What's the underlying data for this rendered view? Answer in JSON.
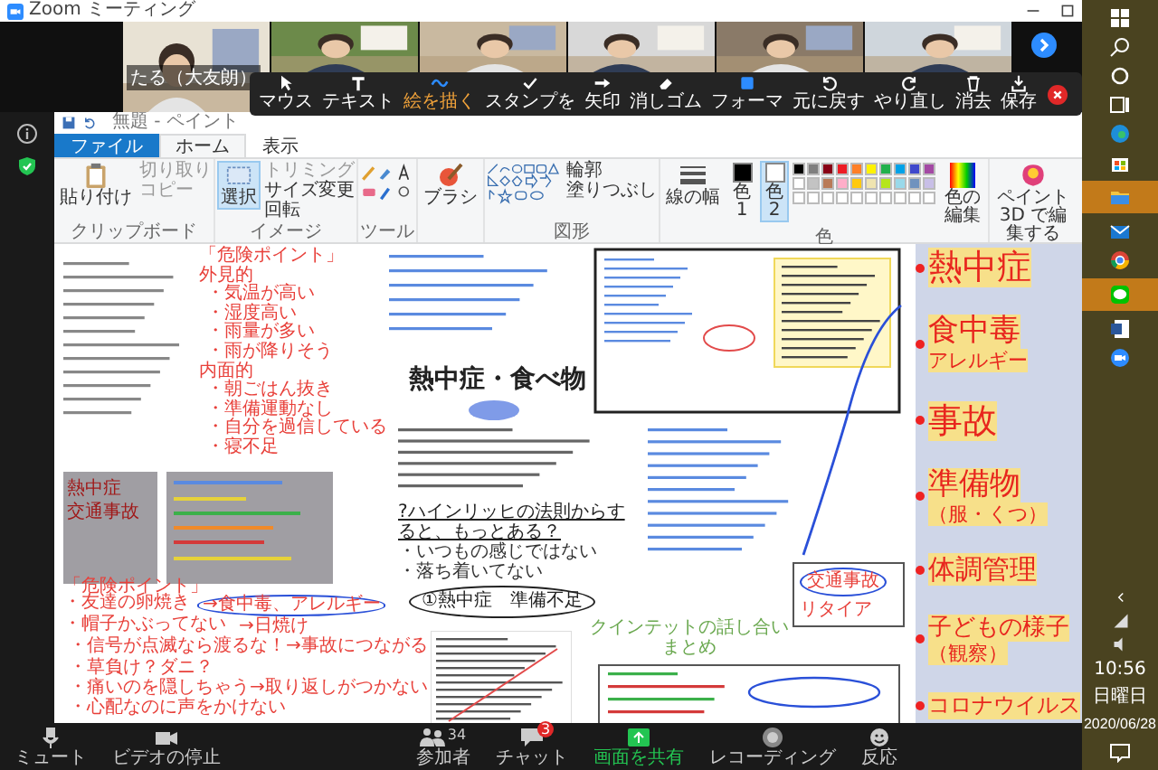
{
  "window": {
    "title": "Zoom ミーティング"
  },
  "video_tiles": [
    {
      "kind": "picture",
      "name": "たる（大友朗）"
    },
    {
      "kind": "picture"
    },
    {
      "kind": "picture"
    },
    {
      "kind": "picture"
    },
    {
      "kind": "picture"
    },
    {
      "kind": "picture"
    }
  ],
  "annotation_toolbar": {
    "tools": [
      {
        "kind": "mouse",
        "label": "マウス",
        "selected": false
      },
      {
        "kind": "text",
        "label": "テキスト",
        "selected": false
      },
      {
        "kind": "draw",
        "label": "絵を描く",
        "selected": true
      },
      {
        "kind": "stamp",
        "label": "スタンプを",
        "selected": false
      },
      {
        "kind": "arrow",
        "label": "矢印",
        "selected": false
      },
      {
        "kind": "eraser",
        "label": "消しゴム",
        "selected": false
      },
      {
        "kind": "format",
        "label": "フォーマ",
        "selected": false
      },
      {
        "kind": "undo",
        "label": "元に戻す",
        "selected": false
      },
      {
        "kind": "redo",
        "label": "やり直し",
        "selected": false
      },
      {
        "kind": "clear",
        "label": "消去",
        "selected": false
      },
      {
        "kind": "save",
        "label": "保存",
        "selected": false
      }
    ]
  },
  "paint": {
    "title": "無題 - ペイント",
    "tabs": [
      {
        "kind": "file",
        "label": "ファイル",
        "selected": false
      },
      {
        "kind": "tab",
        "label": "ホーム",
        "selected": true
      },
      {
        "kind": "tab",
        "label": "表示",
        "selected": false
      }
    ],
    "ribbon": {
      "clipboard": {
        "label": "クリップボード",
        "paste": "貼り付け",
        "cut": "切り取り",
        "copy": "コピー"
      },
      "image": {
        "label": "イメージ",
        "select": "選択",
        "crop": "トリミング",
        "resize": "サイズ変更",
        "rotate": "回転"
      },
      "tools": {
        "label": "ツール"
      },
      "brush": "ブラシ",
      "shapes": {
        "label": "図形",
        "outline": "輪郭",
        "fill": "塗りつぶし"
      },
      "size": "線の幅",
      "color1": {
        "label": "色",
        "number": "1",
        "selected": false
      },
      "color2": {
        "label": "色",
        "number": "2",
        "selected": true
      },
      "colors_label": "色",
      "edit_colors": "色の編集",
      "paint3d": "ペイント 3D で編集する",
      "palette": [
        {
          "color": "#000000"
        },
        {
          "color": "#7f7f7f"
        },
        {
          "color": "#880015"
        },
        {
          "color": "#ed1c24"
        },
        {
          "color": "#ff7f27"
        },
        {
          "color": "#fff200"
        },
        {
          "color": "#22b14c"
        },
        {
          "color": "#00a2e8"
        },
        {
          "color": "#3f48cc"
        },
        {
          "color": "#a349a4"
        },
        {
          "color": "#ffffff"
        },
        {
          "color": "#c3c3c3"
        },
        {
          "color": "#b97a57"
        },
        {
          "color": "#ffaec9"
        },
        {
          "color": "#ffc90e"
        },
        {
          "color": "#efe4b0"
        },
        {
          "color": "#b5e61d"
        },
        {
          "color": "#99d9ea"
        },
        {
          "color": "#7092be"
        },
        {
          "color": "#c8bfe7"
        }
      ]
    },
    "canvas": {
      "danger_points": {
        "title": "「危険ポイント」",
        "sections": [
          {
            "heading": "外見的",
            "items": [
              "・気温が高い",
              "・湿度高い",
              "・雨量が多い",
              "・雨が降りそう"
            ]
          },
          {
            "heading": "内面的",
            "items": [
              "・朝ごはん抜き",
              "・準備運動なし",
              "・自分を過信している",
              "・寝不足"
            ]
          }
        ]
      },
      "gray_box_labels": [
        "熱中症",
        "交通事故"
      ],
      "center_title": "熱中症・食べ物",
      "question": "?ハインリッヒの法則からすると、もっとある？",
      "bullets": [
        "・いつもの感じではない",
        "・落ち着いてない"
      ],
      "oval_text": "①熱中症　準備不足",
      "summary_note": [
        "クインテットの話し合い",
        "まとめ"
      ],
      "accident_box": {
        "label": "交通事故",
        "note": "リタイア"
      },
      "bottom_points": {
        "title": "「危険ポイント」",
        "items": [
          {
            "text": "・友達の卵焼き",
            "note": "→食中毒、アレルギー",
            "circled": true
          },
          {
            "text": "・帽子かぶってない",
            "note": "→日焼け",
            "circled": false
          },
          {
            "text": "・信号が点滅なら渡るな！→事故につながる",
            "circled": false
          },
          {
            "text": "・草負け？ダニ？",
            "circled": false
          },
          {
            "text": "・痛いのを隠しちゃう→取り返しがつかない",
            "circled": false
          },
          {
            "text": "・心配なのに声をかけない",
            "circled": false
          }
        ]
      },
      "topics": [
        {
          "label": "熱中症"
        },
        {
          "label": "食中毒",
          "sub": "アレルギー"
        },
        {
          "label": "事故"
        },
        {
          "label": "準備物",
          "sub": "（服・くつ）"
        },
        {
          "label": "体調管理"
        },
        {
          "label": "子どもの様子",
          "sub": "（観察）"
        },
        {
          "label": "コロナウイルス"
        }
      ]
    }
  },
  "bottom_bar": [
    {
      "kind": "mic",
      "label": "ミュート"
    },
    {
      "kind": "video",
      "label": "ビデオの停止"
    },
    {
      "kind": "participants",
      "label": "参加者",
      "count": "34"
    },
    {
      "kind": "chat",
      "label": "チャット",
      "badge": "3"
    },
    {
      "kind": "share",
      "label": "画面を共有"
    },
    {
      "kind": "record",
      "label": "レコーディング"
    },
    {
      "kind": "react",
      "label": "反応"
    }
  ],
  "taskbar": {
    "time": "10:56",
    "day": "日曜日",
    "date": "2020/06/28"
  }
}
